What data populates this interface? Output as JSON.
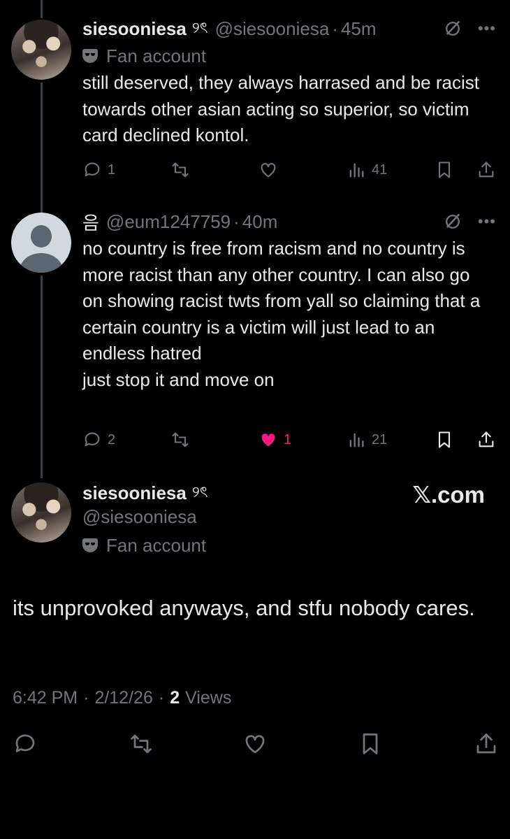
{
  "reply1": {
    "name": "siesooniesa",
    "name_glyph": "୨ৎ",
    "handle": "@siesooniesa",
    "time": "45m",
    "badge": "Fan account",
    "text": "still deserved, they always harrased and be racist towards other asian acting so superior, so victim card declined kontol.",
    "replies": "1",
    "views": "41"
  },
  "reply2": {
    "name_glyph": "음",
    "handle": "@eum1247759",
    "time": "40m",
    "text": "no country is free from racism and no country is more racist than any other country. I can also go on showing racist twts from yall so claiming that a certain country is a victim will just lead to an endless hatred\njust stop it and move on",
    "replies": "2",
    "likes": "1",
    "views": "21"
  },
  "main": {
    "name": "siesooniesa",
    "name_glyph": "୨ৎ",
    "handle": "@siesooniesa",
    "badge": "Fan account",
    "text": "its unprovoked anyways, and stfu nobody cares.",
    "time": "6:42 PM",
    "date": "2/12/26",
    "views_count": "2",
    "views_label": "Views"
  },
  "watermark": "𝕏.com",
  "separator_dot": "·",
  "more_glyph": "•••",
  "colors": {
    "background": "#000000",
    "text": "#e7e9ea",
    "muted": "#71767b",
    "like": "#f91880",
    "thread_line": "#3a3d41"
  }
}
